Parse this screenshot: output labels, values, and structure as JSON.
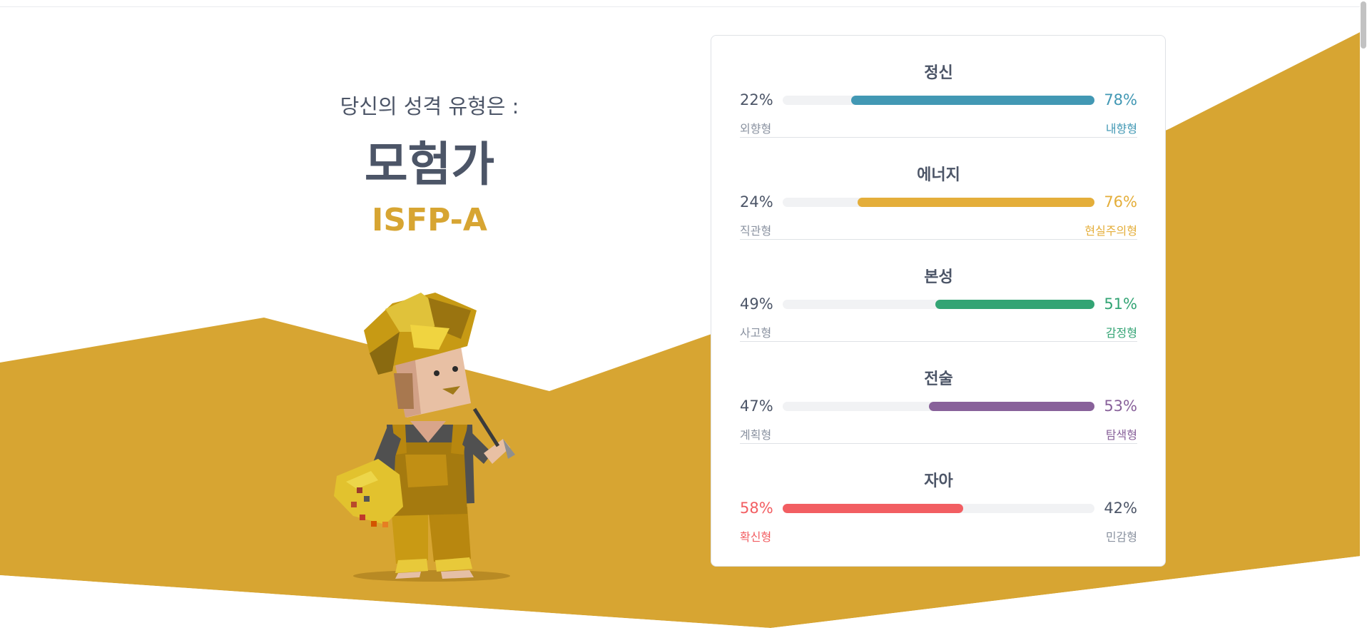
{
  "intro": {
    "lead": "당신의 성격 유형은 :",
    "type_name": "모험가",
    "type_code": "ISFP-A"
  },
  "colors": {
    "background_gold": "#d7a532",
    "text_dark": "#4c5567",
    "text_muted": "#8a92a0"
  },
  "traits": [
    {
      "title": "정신",
      "left_pct": "22%",
      "right_pct": "78%",
      "left_label": "외향형",
      "right_label": "내향형",
      "dominant": "right",
      "dominant_value": 0.78,
      "color": "#4298b4"
    },
    {
      "title": "에너지",
      "left_pct": "24%",
      "right_pct": "76%",
      "left_label": "직관형",
      "right_label": "현실주의형",
      "dominant": "right",
      "dominant_value": 0.76,
      "color": "#e4ae3a"
    },
    {
      "title": "본성",
      "left_pct": "49%",
      "right_pct": "51%",
      "left_label": "사고형",
      "right_label": "감정형",
      "dominant": "right",
      "dominant_value": 0.51,
      "color": "#33a474"
    },
    {
      "title": "전술",
      "left_pct": "47%",
      "right_pct": "53%",
      "left_label": "계획형",
      "right_label": "탐색형",
      "dominant": "right",
      "dominant_value": 0.53,
      "color": "#88619a"
    },
    {
      "title": "자아",
      "left_pct": "58%",
      "right_pct": "42%",
      "left_label": "확신형",
      "right_label": "민감형",
      "dominant": "left",
      "dominant_value": 0.58,
      "color": "#f25e62"
    }
  ]
}
